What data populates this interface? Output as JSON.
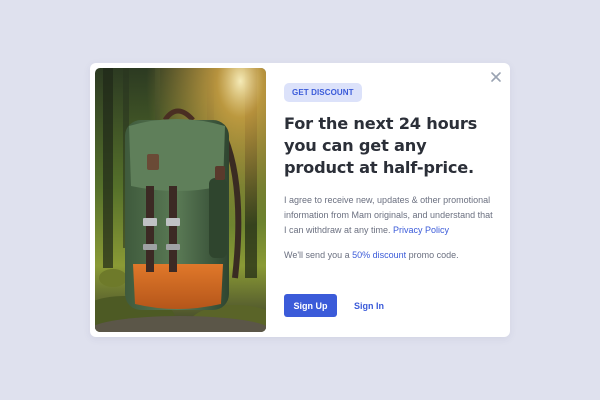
{
  "modal": {
    "badge": "GET DISCOUNT",
    "headline": "For the next 24 hours you can get any product at half-price.",
    "consent_text": "I agree to receive new, updates & other promotional information from Mam originals, and understand that I can withdraw at any time. ",
    "privacy_link": "Privacy Policy",
    "promo_prefix": "We'll send you a ",
    "promo_link": "50% discount",
    "promo_suffix": " promo code.",
    "signup_label": "Sign Up",
    "signin_label": "Sign In"
  },
  "icons": {
    "close": "close-icon"
  },
  "colors": {
    "accent": "#3b5bd9",
    "badge_bg": "#dce2fa",
    "page_bg": "#dfe1ee"
  }
}
